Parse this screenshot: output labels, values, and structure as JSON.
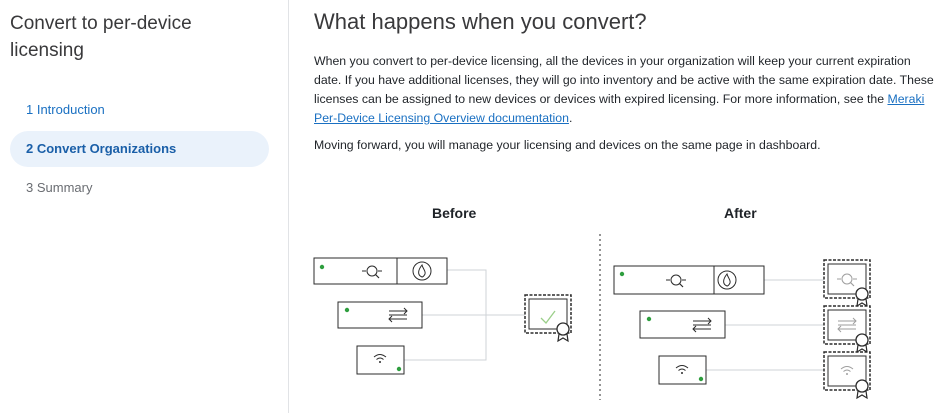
{
  "sidebar": {
    "title": "Convert to per-device licensing",
    "steps": [
      {
        "label": "1 Introduction"
      },
      {
        "label": "2 Convert Organizations"
      },
      {
        "label": "3 Summary"
      }
    ]
  },
  "main": {
    "title": "What happens when you convert?",
    "paragraph1_text": "When you convert to per-device licensing, all the devices in your organization will keep your current expiration date. If you have additional licenses, they will go into inventory and be active with the same expiration date. These licenses can be assigned to new devices or devices with expired licensing. For more information, see the ",
    "paragraph1_link": "Meraki Per-Device Licensing Overview documentation",
    "paragraph1_end": ".",
    "paragraph2": "Moving forward, you will manage your licensing and devices on the same page in dashboard."
  },
  "diagram": {
    "before_label": "Before",
    "after_label": "After"
  },
  "colors": {
    "accent": "#1a70c2",
    "active_step_bg": "#eaf2fb",
    "status_green": "#2e9e3e",
    "check_green": "#9bcf8a"
  },
  "icons": [
    "security-appliance-icon",
    "firewall-icon",
    "switch-icon",
    "wireless-access-point-icon",
    "license-certificate-icon"
  ]
}
